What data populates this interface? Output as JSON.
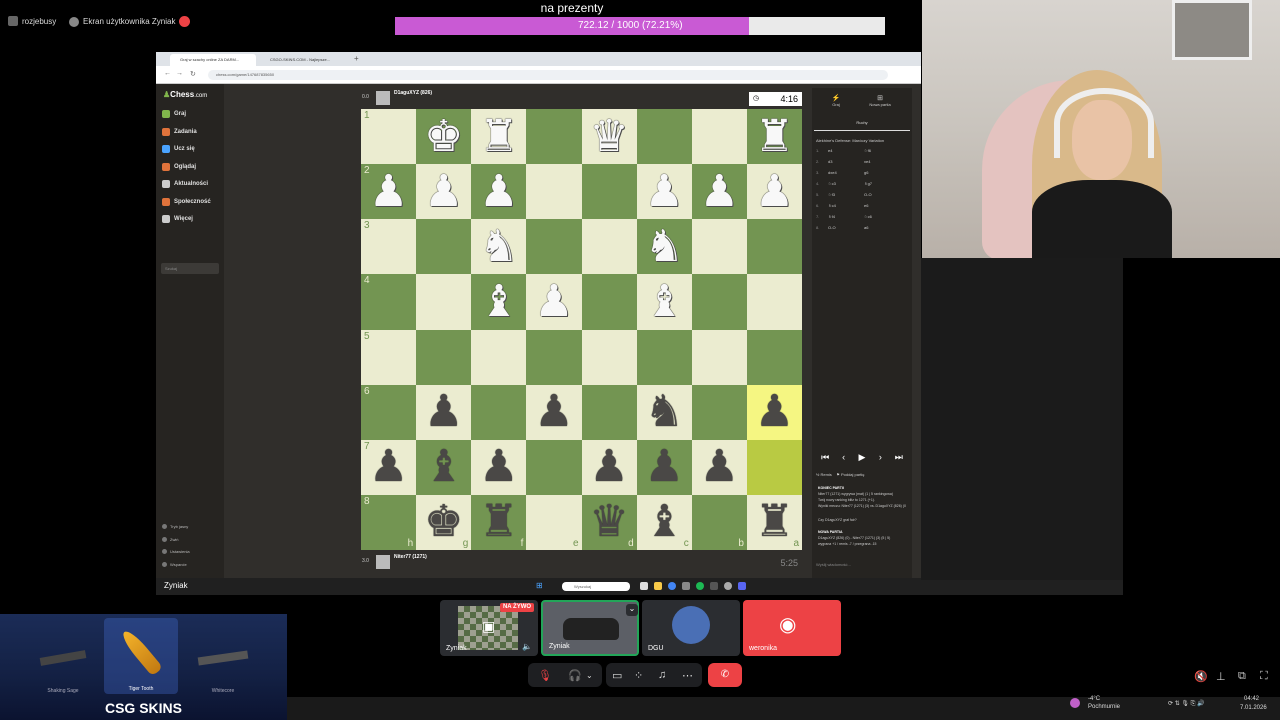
{
  "top": {
    "user1": "rozjebusy",
    "user2": "Ekran użytkownika Zyniak"
  },
  "goal": {
    "title": "na prezenty",
    "progress_text": "722.12 / 1000 (72.21%)",
    "fraction": 0.7221
  },
  "browser": {
    "tab1": "Graj w szachy online ZA DARM...",
    "tab2": "CSGO-SKINS.COM - Najlepsze...",
    "url": "chess.com/game/147687835650"
  },
  "sidebar": {
    "logo": "Chess",
    "logo_suffix": ".com",
    "items": [
      "Graj",
      "Zadania",
      "Ucz się",
      "Oglądaj",
      "Aktualności",
      "Społeczność",
      "Więcej"
    ],
    "search_placeholder": "Szukaj",
    "bottom": [
      "Tryb jasny",
      "Zwiń",
      "Ustawienia",
      "Wsparcie"
    ]
  },
  "players": {
    "top_name": "D1aguXYZ (826)",
    "top_score": "0.0",
    "top_clock": "4:16",
    "bottom_name": "Niter77 (1271)",
    "bottom_score": "3.0",
    "bottom_clock": "5:25"
  },
  "board": {
    "ranks": [
      "1",
      "2",
      "3",
      "4",
      "5",
      "6",
      "7",
      "8"
    ],
    "files": [
      "h",
      "g",
      "f",
      "e",
      "d",
      "c",
      "b",
      "a"
    ],
    "rows": [
      [
        " ",
        "wK",
        "wR",
        " ",
        "wQ",
        " ",
        " ",
        "wR"
      ],
      [
        "wP",
        "wP",
        "wP",
        " ",
        " ",
        "wP",
        "wP",
        "wP"
      ],
      [
        " ",
        " ",
        "wN",
        " ",
        " ",
        "wN",
        " ",
        " "
      ],
      [
        " ",
        " ",
        "wB",
        "wP",
        " ",
        "wB",
        " ",
        " "
      ],
      [
        " ",
        " ",
        " ",
        " ",
        " ",
        " ",
        " ",
        " "
      ],
      [
        " ",
        "bP",
        " ",
        "bP",
        " ",
        "bN",
        " ",
        "bP"
      ],
      [
        "bP",
        "bB",
        "bP",
        " ",
        "bP",
        "bP",
        "bP",
        " "
      ],
      [
        " ",
        "bK",
        "bR",
        " ",
        "bQ",
        "bB",
        " ",
        "bR"
      ]
    ],
    "highlight": [
      [
        5,
        7
      ],
      [
        6,
        7
      ]
    ]
  },
  "panel": {
    "tab_play": "Graj",
    "tab_new": "Nowa partia",
    "moves_label": "Ruchy",
    "opening": "Alekhine's Defense: Maróczy Variation",
    "moves": [
      [
        "1.",
        "e4",
        "♘f6"
      ],
      [
        "2.",
        "d3",
        "xe4"
      ],
      [
        "3.",
        "dxe4",
        "g6"
      ],
      [
        "4.",
        "♘c3",
        "♗g7"
      ],
      [
        "5.",
        "♘f3",
        "O-O"
      ],
      [
        "6.",
        "♗c4",
        "e6"
      ],
      [
        "7.",
        "♗f4",
        "♘c6"
      ],
      [
        "8.",
        "O-O",
        "a6"
      ]
    ],
    "draw": "Remis",
    "resign": "Poddaj partię",
    "chat": [
      "KONIEC PARTII",
      "Niter77 (1271) wygrywa (mat) (1 | 5 rankingowa)",
      "Twój nowy ranking blitz to 1271 (+1).",
      "Wyniki meczu: Niter77 (1271) (3) vs. D1aguXYZ (826) (0)",
      "Czy D1aguXYZ grał fair?",
      "NOWA PARTIA",
      "D1aguXYZ (826) (0) - Niter77 (1271) (3) (5 | 5)",
      "wygrana +1 / remis -7 / przegrana -15"
    ],
    "chat_placeholder": "Wyślij wiadomość..."
  },
  "taskbar": {
    "label": "Zyniak",
    "search": "Wyszukaj"
  },
  "tiles": {
    "live": "NA ŻYWO",
    "names": [
      "Zyniak",
      "Zyniak",
      "DGU",
      "weronika"
    ]
  },
  "skins": {
    "title": "CSG SKINS",
    "cards": [
      "Shaking Sage",
      "Tiger Tooth",
      "Whitecore"
    ]
  },
  "tray": {
    "weather_temp": "-4°C",
    "weather_desc": "Pochmurnie",
    "time": "04:42",
    "date": "7.01.2026"
  },
  "colors": {
    "goal": "#c95ad4",
    "board_light": "#ebecd0",
    "board_dark": "#739552",
    "discord_red": "#ed4245"
  }
}
